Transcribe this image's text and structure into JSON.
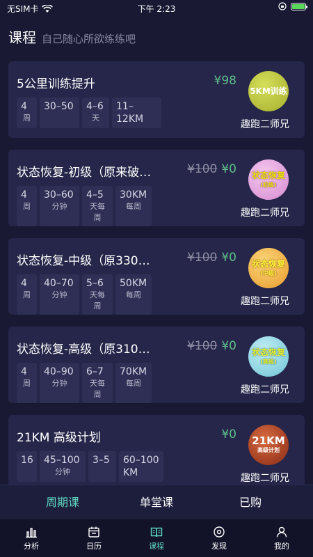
{
  "status": {
    "carrier": "无SIM卡",
    "time": "下午 2:23"
  },
  "header": {
    "title": "课程",
    "subtitle": "自己随心所欲练练吧"
  },
  "courses": [
    {
      "name": "5公里训练提升",
      "old_price": "",
      "price": "¥98",
      "stats": [
        {
          "v": "4",
          "u": "周"
        },
        {
          "v": "30–50",
          "u": ""
        },
        {
          "v": "4–6",
          "u": "天"
        },
        {
          "v": "11–12KM",
          "u": ""
        }
      ],
      "badge": {
        "main": "5KM训练",
        "sub": "",
        "color": "#b7c23c"
      },
      "coach": "趣跑二师兄"
    },
    {
      "name": "状态恢复-初级（原来破…",
      "old_price": "¥100",
      "price": "¥0",
      "stats": [
        {
          "v": "4",
          "u": "周"
        },
        {
          "v": "30–60",
          "u": "分钟"
        },
        {
          "v": "4–5",
          "u": "天每周"
        },
        {
          "v": "30KM",
          "u": "每周"
        }
      ],
      "badge": {
        "main": "状态恢复",
        "sub": "(初级)",
        "color": "#e6a6e0"
      },
      "coach": "趣跑二师兄"
    },
    {
      "name": "状态恢复-中级（原330…",
      "old_price": "¥100",
      "price": "¥0",
      "stats": [
        {
          "v": "4",
          "u": "周"
        },
        {
          "v": "40–70",
          "u": "分钟"
        },
        {
          "v": "5–6",
          "u": "天每周"
        },
        {
          "v": "50KM",
          "u": "每周"
        }
      ],
      "badge": {
        "main": "状态恢复",
        "sub": "(中级)",
        "color": "#f5b84a"
      },
      "coach": "趣跑二师兄"
    },
    {
      "name": "状态恢复-高级（原310…",
      "old_price": "¥100",
      "price": "¥0",
      "stats": [
        {
          "v": "4",
          "u": "周"
        },
        {
          "v": "40–90",
          "u": "分钟"
        },
        {
          "v": "6–7",
          "u": "天每周"
        },
        {
          "v": "70KM",
          "u": "每周"
        }
      ],
      "badge": {
        "main": "状态恢复",
        "sub": "(高级)",
        "color": "#8fd8e6"
      },
      "coach": "趣跑二师兄"
    },
    {
      "name": "21KM 高级计划",
      "old_price": "",
      "price": "¥0",
      "stats": [
        {
          "v": "16",
          "u": ""
        },
        {
          "v": "45–100",
          "u": "分钟"
        },
        {
          "v": "3–5",
          "u": ""
        },
        {
          "v": "60–100KM",
          "u": ""
        }
      ],
      "badge": {
        "main": "21KM",
        "sub": "高级计划",
        "color": "#b6462a"
      },
      "coach": "趣跑二师兄"
    }
  ],
  "tabs": [
    {
      "label": "周期课"
    },
    {
      "label": "单堂课"
    },
    {
      "label": "已购"
    }
  ],
  "nav": [
    {
      "label": "分析",
      "icon": "chart-icon"
    },
    {
      "label": "日历",
      "icon": "calendar-icon"
    },
    {
      "label": "课程",
      "icon": "book-icon"
    },
    {
      "label": "发现",
      "icon": "compass-icon"
    },
    {
      "label": "我的",
      "icon": "user-icon"
    }
  ],
  "colors": {
    "accent": "#5fd6c0",
    "price": "#5fc08c",
    "background": "#191933",
    "card": "#26264a"
  }
}
